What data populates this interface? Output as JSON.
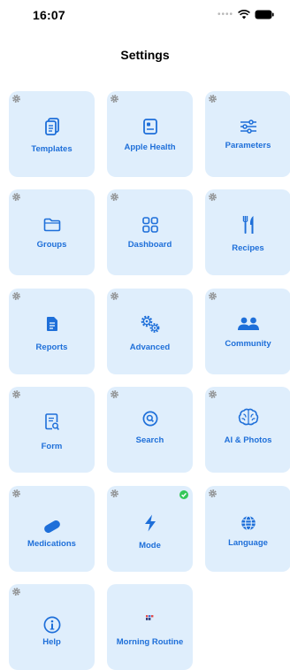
{
  "status_bar": {
    "time": "16:07"
  },
  "header": {
    "title": "Settings"
  },
  "colors": {
    "accent": "#1e6fd9",
    "tile_bg": "#dfeefc",
    "check_green": "#34c759",
    "gear_gray": "#8a8a8a"
  },
  "tiles": [
    {
      "label": "Templates",
      "icon": "templates-icon"
    },
    {
      "label": "Apple Health",
      "icon": "apple-health-icon"
    },
    {
      "label": "Parameters",
      "icon": "parameters-icon"
    },
    {
      "label": "Groups",
      "icon": "folder-icon"
    },
    {
      "label": "Dashboard",
      "icon": "dashboard-icon"
    },
    {
      "label": "Recipes",
      "icon": "fork-knife-icon"
    },
    {
      "label": "Reports",
      "icon": "reports-icon"
    },
    {
      "label": "Advanced",
      "icon": "gears-icon"
    },
    {
      "label": "Community",
      "icon": "people-icon"
    },
    {
      "label": "Form",
      "icon": "form-icon"
    },
    {
      "label": "Search",
      "icon": "search-icon"
    },
    {
      "label": "AI & Photos",
      "icon": "brain-icon"
    },
    {
      "label": "Medications",
      "icon": "pill-icon"
    },
    {
      "label": "Mode",
      "icon": "bolt-icon",
      "active": true
    },
    {
      "label": "Language",
      "icon": "globe-icon"
    },
    {
      "label": "Help",
      "icon": "info-icon"
    },
    {
      "label": "Morning Routine",
      "icon": "routine-icon"
    }
  ]
}
